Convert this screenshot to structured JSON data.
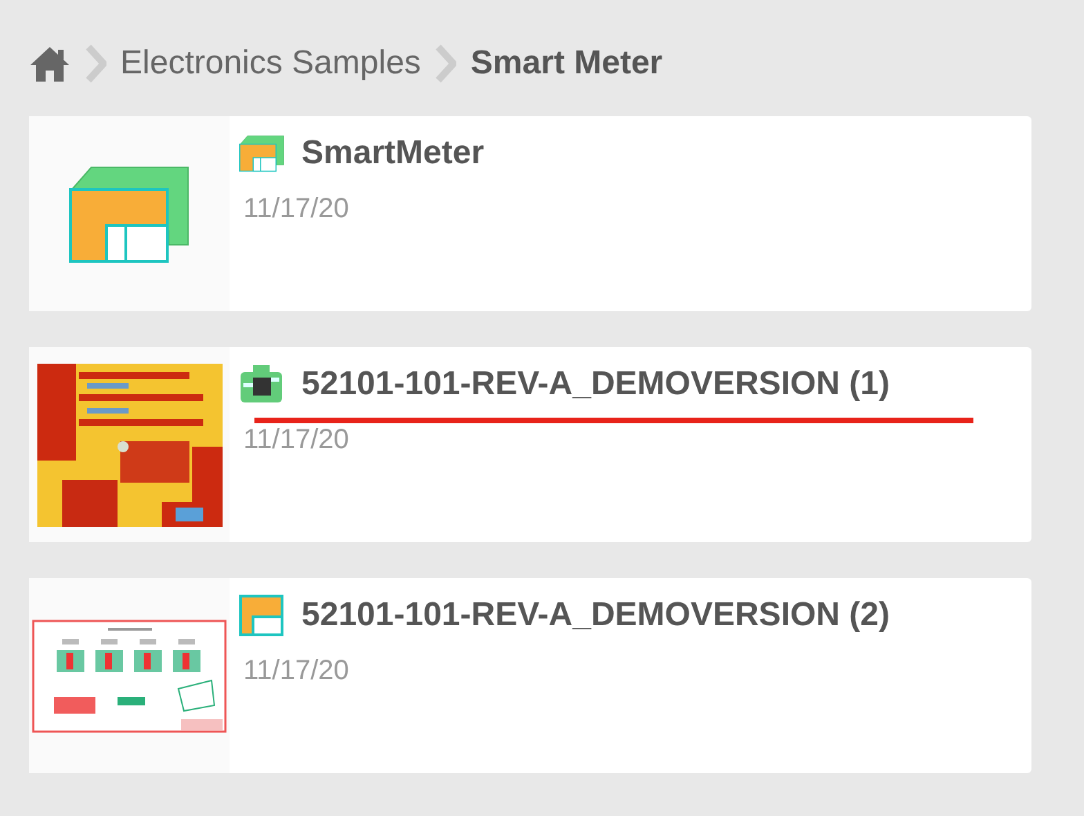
{
  "breadcrumb": {
    "items": [
      {
        "label": "Electronics Samples",
        "current": false
      },
      {
        "label": "Smart Meter",
        "current": true
      }
    ]
  },
  "items": [
    {
      "kind": "design",
      "name": "SmartMeter",
      "date": "11/17/20",
      "underlined": false
    },
    {
      "kind": "pcb",
      "name": "52101-101-REV-A_DEMOVERSION (1)",
      "date": "11/17/20",
      "underlined": true
    },
    {
      "kind": "schematic",
      "name": "52101-101-REV-A_DEMOVERSION (2)",
      "date": "11/17/20",
      "underlined": false
    }
  ]
}
